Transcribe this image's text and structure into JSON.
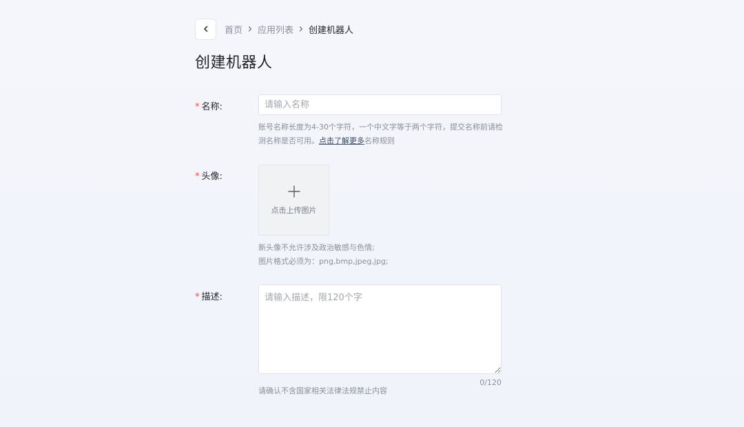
{
  "breadcrumb": {
    "items": [
      "首页",
      "应用列表",
      "创建机器人"
    ]
  },
  "page_title": "创建机器人",
  "form": {
    "name": {
      "label": "名称:",
      "required_mark": "*",
      "placeholder": "请输入名称",
      "value": "",
      "hint_text": "账号名称长度为4-30个字符，一个中文字等于两个字符，提交名称前请检测名称是否可用。",
      "hint_link": "点击了解更多",
      "hint_suffix": "名称规则"
    },
    "avatar": {
      "label": "头像:",
      "required_mark": "*",
      "upload_text": "点击上传图片",
      "hint_line1": "新头像不允许涉及政治敏感与色情;",
      "hint_line2": "图片格式必须为：png,bmp,jpeg,jpg;"
    },
    "description": {
      "label": "描述:",
      "required_mark": "*",
      "placeholder": "请输入描述，限120个字",
      "value": "",
      "counter": "0/120",
      "hint": "请确认不含国家相关法律法规禁止内容"
    }
  },
  "colors": {
    "background": "#f3f5fb",
    "required": "#f54a45",
    "link": "#3a4a66",
    "text": "#1f2329",
    "muted": "#8a8f99"
  },
  "icons": {
    "back": "chevron-left-icon",
    "separator": "chevron-right-icon",
    "upload": "plus-icon"
  }
}
